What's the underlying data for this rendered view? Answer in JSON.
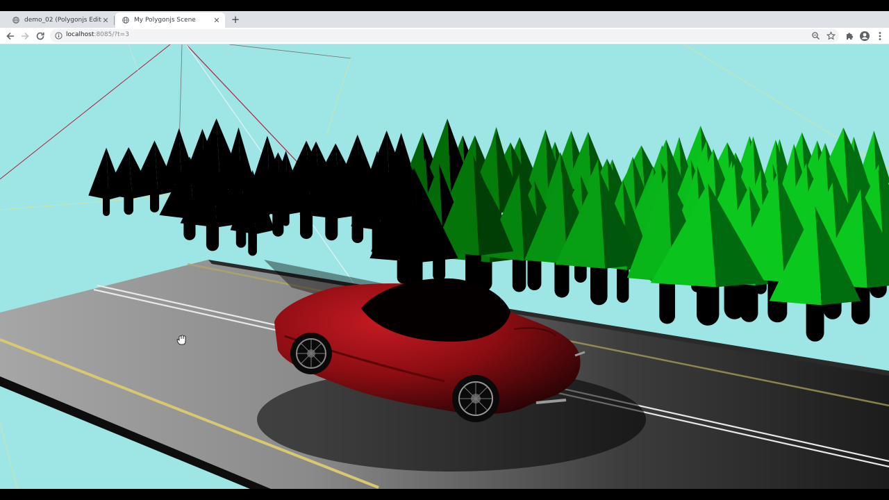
{
  "browser": {
    "tabs": [
      {
        "label": "demo_02 (Polygonjs Editor)",
        "active": false
      },
      {
        "label": "My Polygonjs Scene",
        "active": true
      }
    ],
    "new_tab_icon": "plus-icon",
    "url": {
      "host": "localhost",
      "path": ":8085/?t=3"
    },
    "toolbar_icons": [
      "back-arrow-icon",
      "forward-arrow-icon",
      "reload-icon",
      "info-icon",
      "zoom-icon",
      "star-icon",
      "extensions-icon",
      "profile-icon",
      "menu-icon"
    ]
  },
  "scene": {
    "title": "My Polygonjs Scene",
    "background_color": "#9ee6e6",
    "objects": [
      "pine-trees",
      "road-plane",
      "red-convertible-car",
      "camera-frustum-lines"
    ],
    "road_color": "#6e6e6e",
    "car_color": "#8b0d12",
    "tree_color_lit": "#22c23a",
    "tree_color_shadow": "#000000"
  }
}
